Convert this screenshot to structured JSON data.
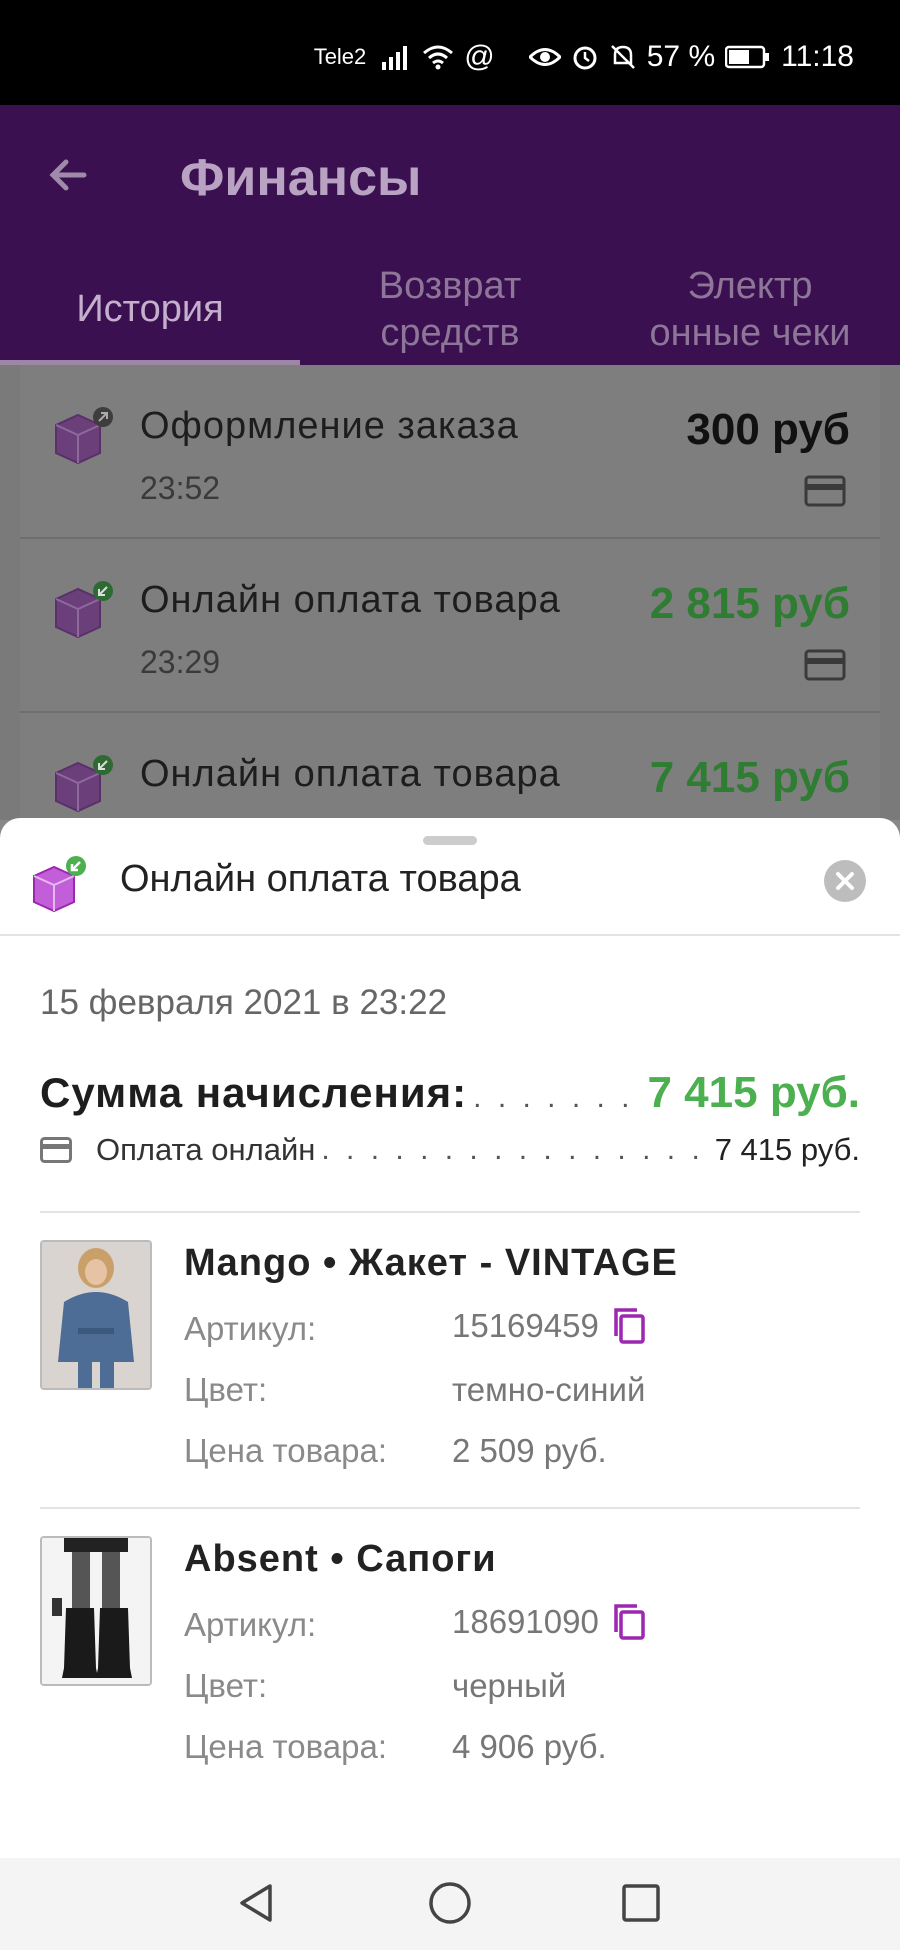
{
  "status_bar": {
    "carrier": "Tele2",
    "battery": "57 %",
    "time": "11:18"
  },
  "header": {
    "title": "Финансы"
  },
  "tabs": [
    {
      "label": "История",
      "active": true
    },
    {
      "label": "Возврат средств",
      "active": false
    },
    {
      "label": "Электр онные чеки",
      "active": false
    }
  ],
  "history": [
    {
      "title": "Оформление заказа",
      "time": "23:52",
      "amount": "300 руб",
      "amount_color": "#111111"
    },
    {
      "title": "Онлайн оплата товара",
      "time": "23:29",
      "amount": "2 815 руб",
      "amount_color": "#2e7d32"
    },
    {
      "title": "Онлайн оплата товара",
      "time": "",
      "amount": "7 415 руб",
      "amount_color": "#2e7d32"
    }
  ],
  "sheet": {
    "title": "Онлайн оплата товара",
    "date": "15 февраля 2021 в 23:22",
    "sum_label": "Сумма начисления:",
    "sum_value": "7 415 руб.",
    "payment_label": "Оплата онлайн",
    "payment_value": "7 415 руб.",
    "products": [
      {
        "name": "Mango • Жакет - VINTAGE",
        "article_label": "Артикул:",
        "article": "15169459",
        "color_label": "Цвет:",
        "color": "темно-синий",
        "price_label": "Цена товара:",
        "price": "2 509 руб."
      },
      {
        "name": "Absent • Сапоги",
        "article_label": "Артикул:",
        "article": "18691090",
        "color_label": "Цвет:",
        "color": "черный",
        "price_label": "Цена товара:",
        "price": "4 906 руб."
      }
    ]
  },
  "colors": {
    "accent_purple": "#9c27b0",
    "success_green": "#4caf50",
    "appbar": "#3a1050"
  },
  "icons": [
    "back-arrow-icon",
    "box-out-icon",
    "box-in-icon",
    "card-icon",
    "close-icon",
    "copy-icon",
    "nav-back-icon",
    "nav-home-icon",
    "nav-recents-icon"
  ]
}
